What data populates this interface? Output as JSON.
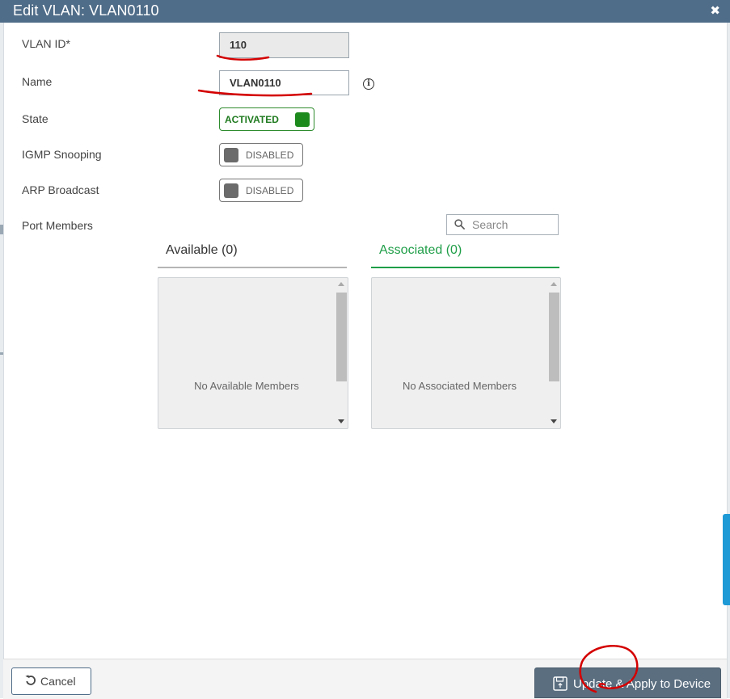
{
  "dialog": {
    "title": "Edit VLAN: VLAN0110",
    "close_icon": "close-icon"
  },
  "form": {
    "vlan_id": {
      "label": "VLAN ID*",
      "value": "110"
    },
    "name": {
      "label": "Name",
      "value": "VLAN0110",
      "info_icon": "info-icon"
    },
    "state": {
      "label": "State",
      "toggle_text": "ACTIVATED",
      "on": true
    },
    "igmp_snooping": {
      "label": "IGMP Snooping",
      "toggle_text": "DISABLED",
      "on": false
    },
    "arp_broadcast": {
      "label": "ARP Broadcast",
      "toggle_text": "DISABLED",
      "on": false
    },
    "port_members": {
      "label": "Port Members",
      "search_placeholder": "Search",
      "available": {
        "title": "Available (0)",
        "empty_text": "No Available Members"
      },
      "associated": {
        "title": "Associated (0)",
        "empty_text": "No Associated Members"
      }
    }
  },
  "footer": {
    "cancel_label": "Cancel",
    "apply_label": "Update & Apply to Device"
  },
  "colors": {
    "title_bar": "#4f6c88",
    "activated_green": "#1d8a1d",
    "associated_green": "#1f9e48",
    "annotation_red": "#d40000",
    "apply_button": "#5a6e80"
  }
}
